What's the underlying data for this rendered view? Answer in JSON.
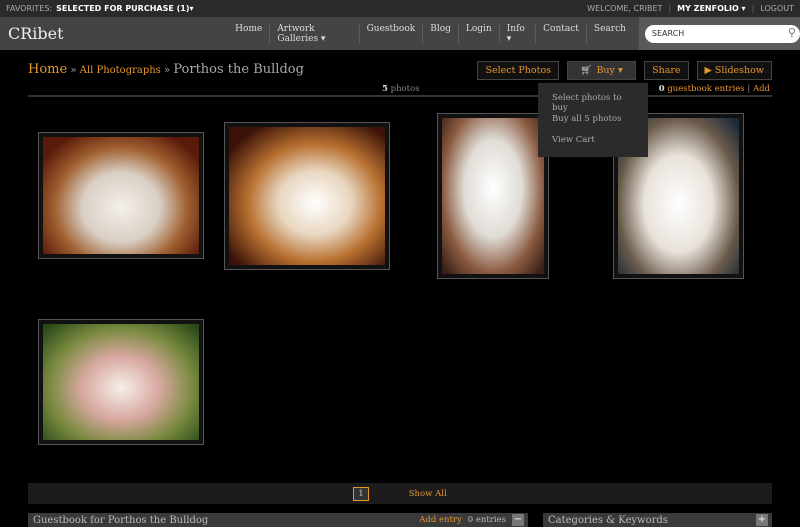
{
  "topbar": {
    "favorites_label": "Favorites:",
    "favorites_value": "Selected for Purchase (1)▾",
    "welcome": "Welcome, CRibet",
    "my_zenfolio": "My Zenfolio ▾",
    "logout": "Logout"
  },
  "header": {
    "logo": "CRibet",
    "nav": [
      "Home",
      "Artwork Galleries ▾",
      "Guestbook",
      "Blog",
      "Login",
      "Info ▾",
      "Contact",
      "Search"
    ],
    "search_placeholder": "SEARCH"
  },
  "breadcrumb": {
    "home": "Home",
    "sep": " » ",
    "parent": "All Photographs",
    "current": "Porthos the Bulldog"
  },
  "toolbar": {
    "select": "Select Photos",
    "buy": "Buy ▾",
    "share": "Share",
    "slideshow": "▶ Slideshow"
  },
  "buy_menu": [
    "Select photos to buy",
    "Buy all 5 photos",
    "View Cart"
  ],
  "stats": {
    "count": "5",
    "count_label": " photos",
    "gb_count": "0",
    "gb_label": " guestbook entries",
    "gb_add": "Add"
  },
  "photos": [
    "Bulldog photo 1",
    "Bulldog photo 2",
    "Bulldog photo 3",
    "Bulldog photo 4",
    "Bulldog photo 5"
  ],
  "pager": {
    "page": "1",
    "show_all": "Show All"
  },
  "panels": {
    "guestbook_title": "Guestbook for Porthos the Bulldog",
    "add_entry": "Add entry",
    "entries": "0 entries",
    "categories_title": "Categories & Keywords"
  },
  "colors": {
    "accent": "#e8962c"
  }
}
